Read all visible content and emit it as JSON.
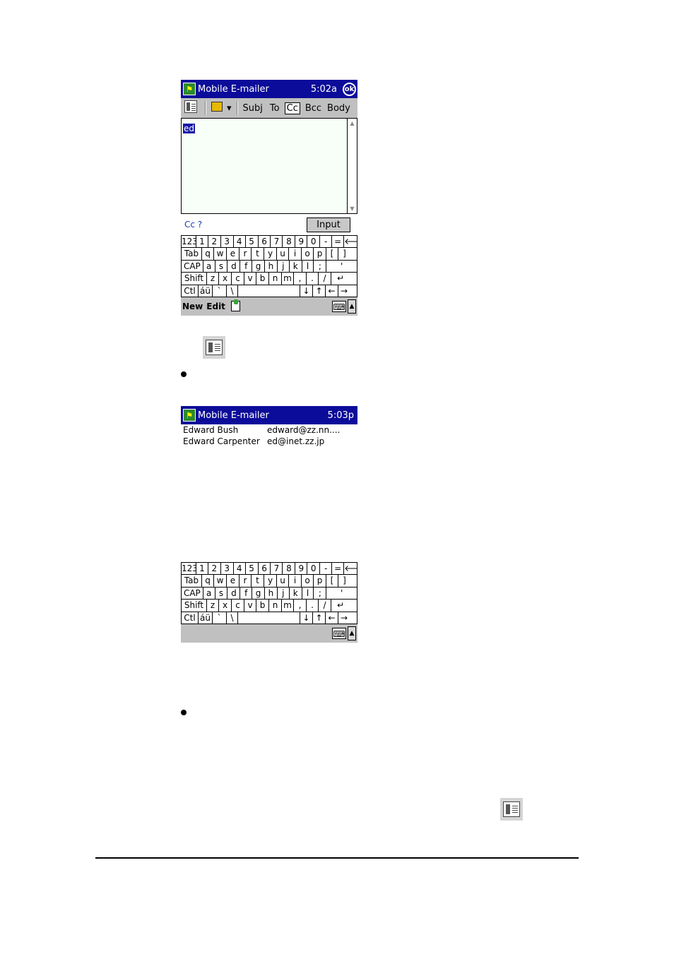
{
  "screen1": {
    "title": "Mobile E-mailer",
    "time": "5:02a",
    "ok": "ok",
    "toolbar": {
      "subj": "Subj",
      "to": "To",
      "cc": "Cc",
      "bcc": "Bcc",
      "body": "Body",
      "dropdown": "▾"
    },
    "selected_text": "ed",
    "prompt": "Cc ?",
    "input_button": "Input",
    "menu": {
      "new": "New",
      "edit": "Edit"
    }
  },
  "screen2": {
    "title": "Mobile E-mailer",
    "time": "5:03p",
    "contacts": [
      {
        "name": "Edward Bush",
        "email": "edward@zz.nn...."
      },
      {
        "name": "Edward Carpenter",
        "email": "ed@inet.zz.jp"
      }
    ]
  },
  "keyboard": {
    "rows": [
      [
        "123",
        "1",
        "2",
        "3",
        "4",
        "5",
        "6",
        "7",
        "8",
        "9",
        "0",
        "-",
        "=",
        "🡐"
      ],
      [
        "Tab",
        "q",
        "w",
        "e",
        "r",
        "t",
        "y",
        "u",
        "i",
        "o",
        "p",
        "[",
        "]"
      ],
      [
        "CAP",
        "a",
        "s",
        "d",
        "f",
        "g",
        "h",
        "j",
        "k",
        "l",
        ";",
        "'"
      ],
      [
        "Shift",
        "z",
        "x",
        "c",
        "v",
        "b",
        "n",
        "m",
        ",",
        ".",
        "/",
        "↵"
      ],
      [
        "Ctl",
        "áü",
        "`",
        "\\",
        "",
        "↓",
        "↑",
        "←",
        "→"
      ]
    ]
  },
  "icons": [
    "address-book-icon",
    "book-icon",
    "note-icon",
    "keyboard-icon",
    "ok-icon"
  ]
}
